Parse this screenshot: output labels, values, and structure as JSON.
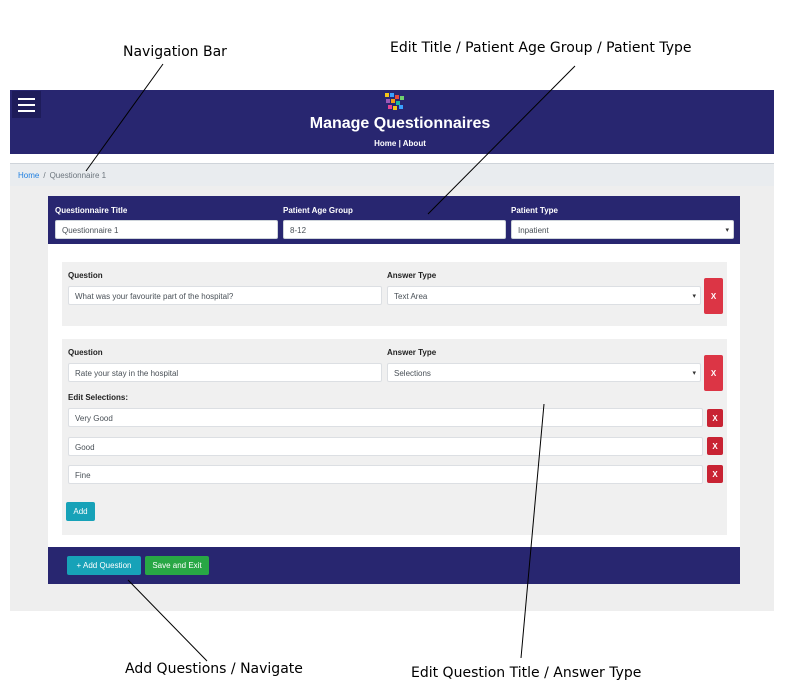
{
  "annotations": {
    "nav_bar": "Navigation Bar",
    "edit_title": "Edit Title / Patient Age Group / Patient Type",
    "add_questions": "Add Questions / Navigate",
    "edit_question": "Edit Question Title / Answer Type"
  },
  "navbar": {
    "title": "Manage Questionnaires",
    "links": [
      "Home",
      "About"
    ],
    "link_separator": "|",
    "menu_icon": "hamburger-menu-icon",
    "bg_color": "#282670"
  },
  "breadcrumb": {
    "home": "Home",
    "separator": "/",
    "current": "Questionnaire 1"
  },
  "header": {
    "title_label": "Questionnaire Title",
    "title_value": "Questionnaire 1",
    "age_label": "Patient Age Group",
    "age_value": "8-12",
    "type_label": "Patient Type",
    "type_value": "Inpatient"
  },
  "questions": [
    {
      "question_label": "Question",
      "question_value": "What was your favourite part of the hospital?",
      "answer_label": "Answer Type",
      "answer_value": "Text Area",
      "delete_label": "X"
    },
    {
      "question_label": "Question",
      "question_value": "Rate your stay in the hospital",
      "answer_label": "Answer Type",
      "answer_value": "Selections",
      "delete_label": "X",
      "selections_label": "Edit Selections:",
      "selections": [
        "Very Good",
        "Good",
        "Fine"
      ],
      "add_label": "Add"
    }
  ],
  "footer": {
    "add_question": "+ Add Question",
    "save_exit": "Save and Exit"
  },
  "colors": {
    "primary": "#282670",
    "danger": "#dc3545",
    "info": "#17a2b8",
    "success": "#28a745"
  }
}
